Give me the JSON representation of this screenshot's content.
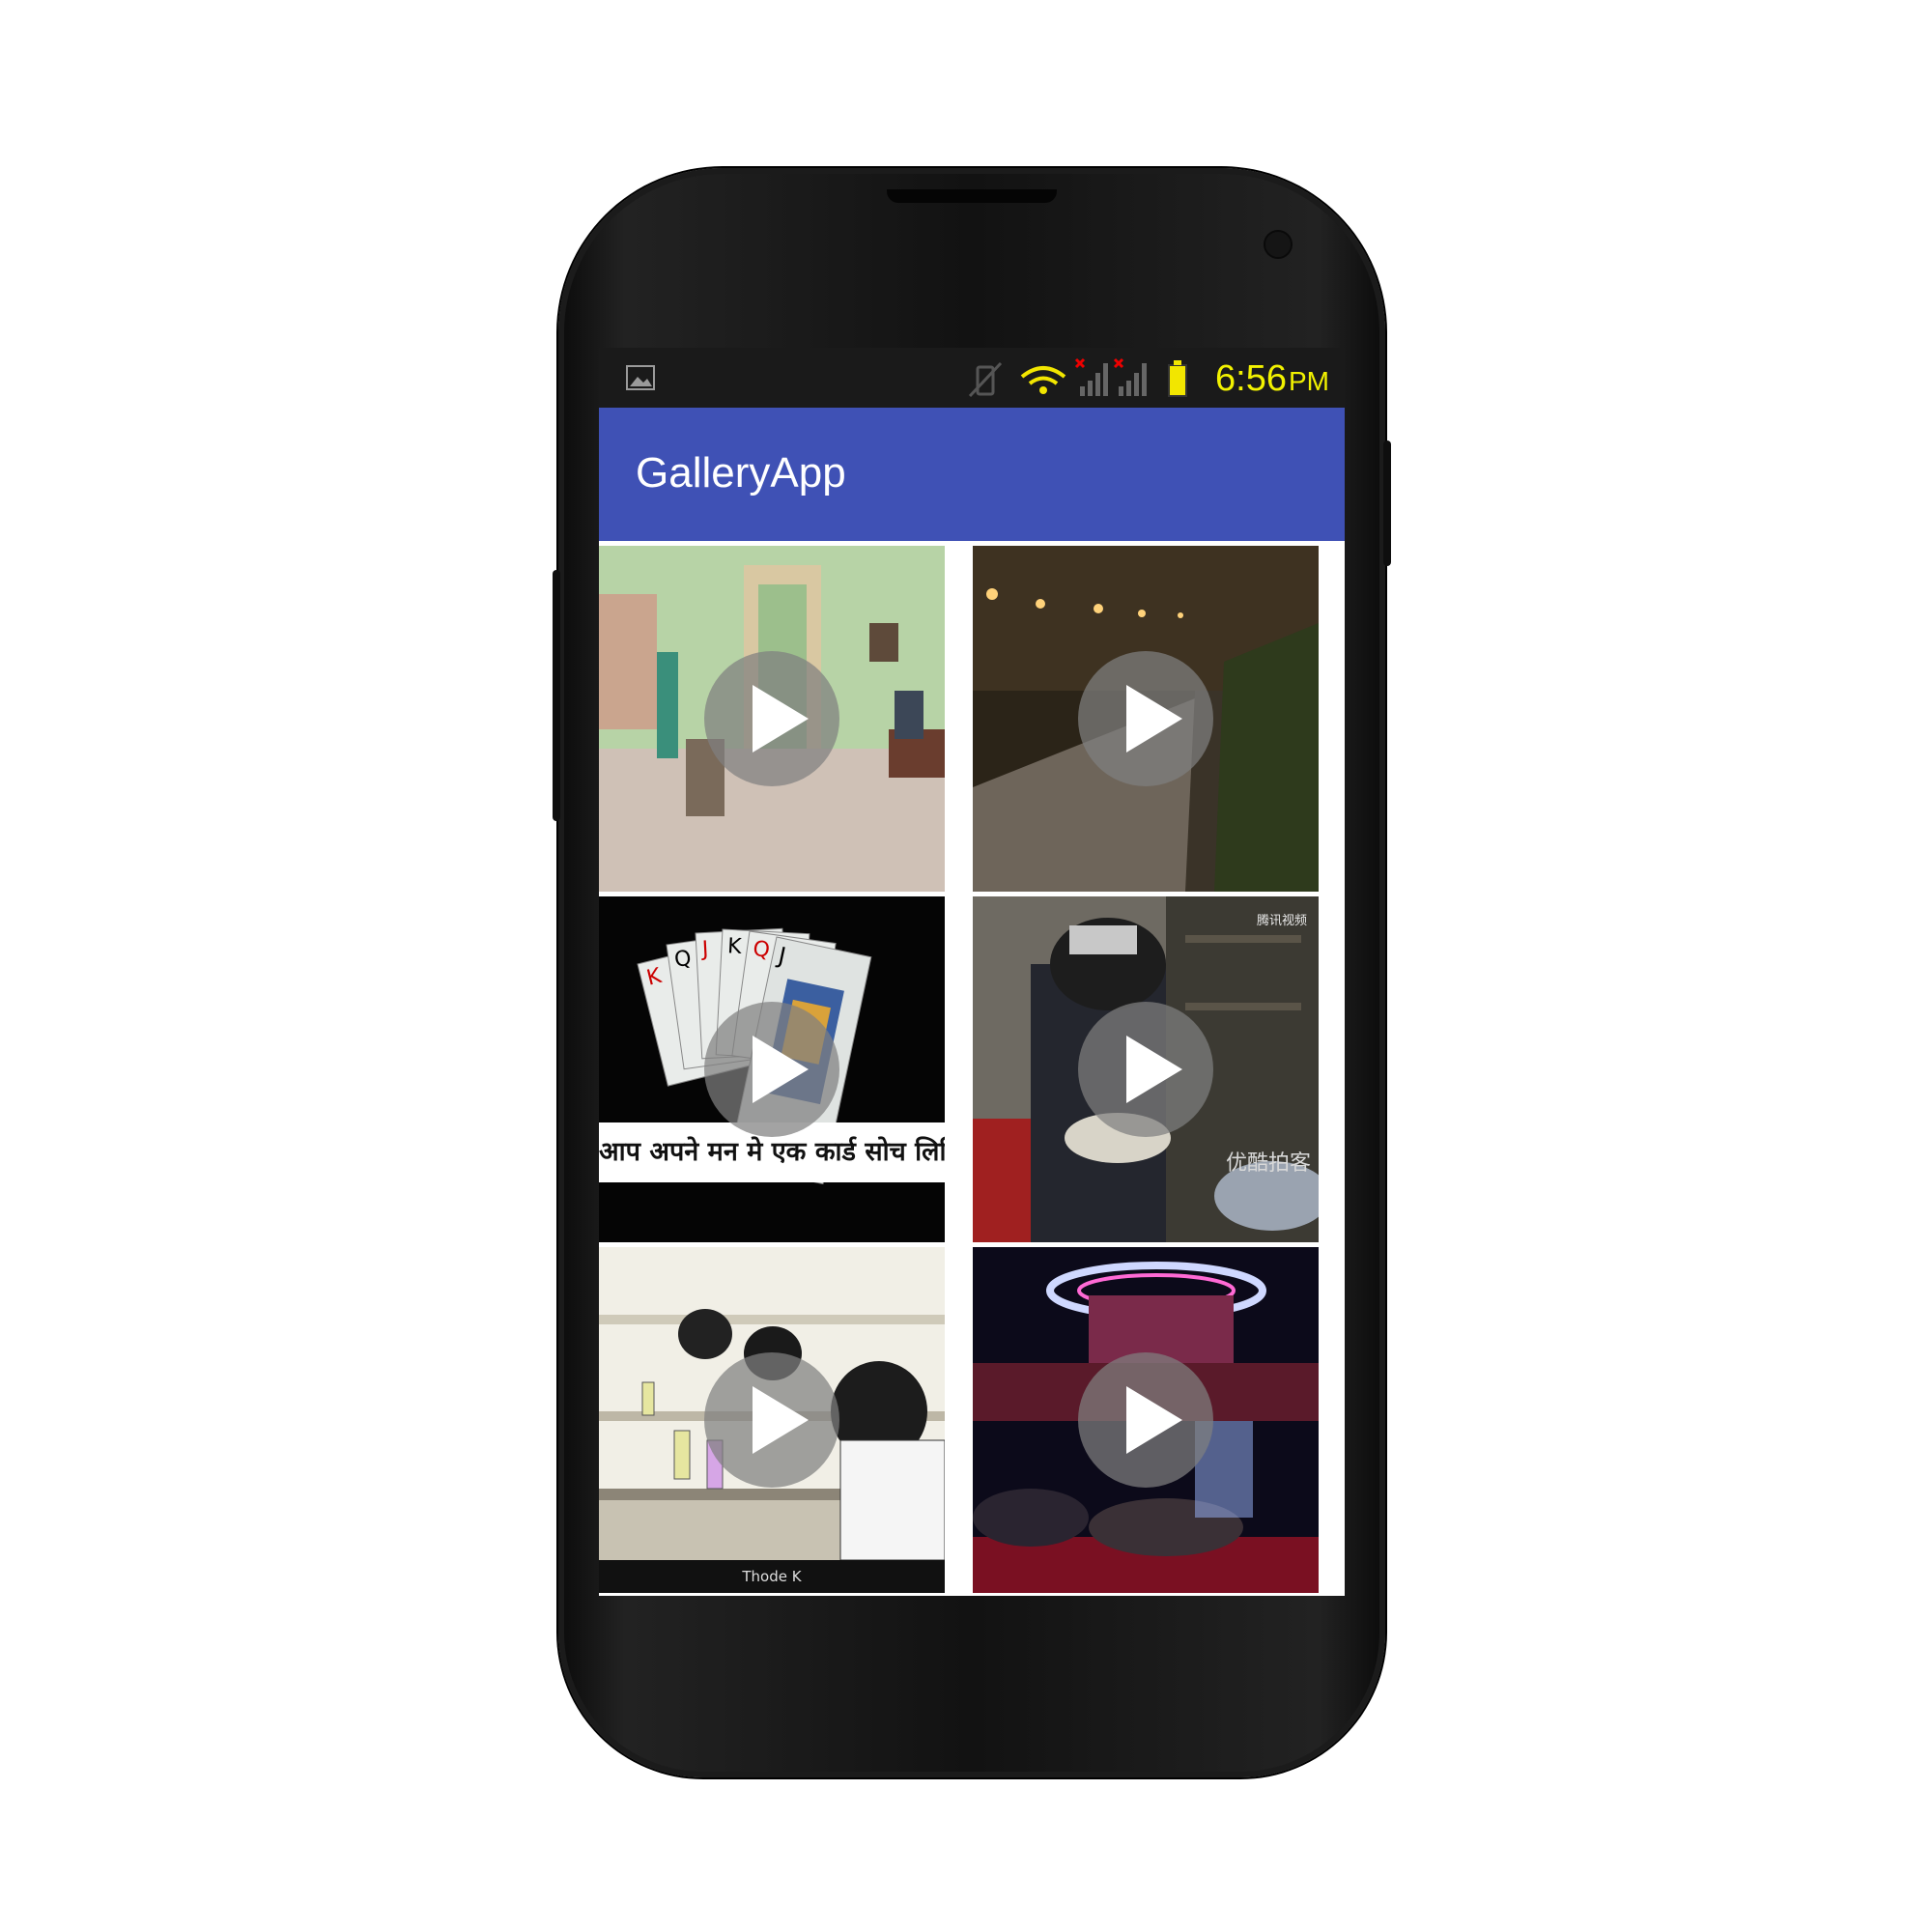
{
  "status_bar": {
    "time": "6:56",
    "ampm": "PM",
    "icons": [
      "image-notification-icon",
      "vibrate-off-icon",
      "wifi-icon",
      "signal-icon",
      "signal-icon",
      "battery-icon"
    ]
  },
  "app_bar": {
    "title": "GalleryApp"
  },
  "gallery": {
    "items": [
      {
        "name": "video-thumb-1",
        "caption": ""
      },
      {
        "name": "video-thumb-2",
        "caption": ""
      },
      {
        "name": "video-thumb-3",
        "caption": "आप अपने मन मे एक कार्ड सोच लिजिए"
      },
      {
        "name": "video-thumb-4",
        "caption": "优酷拍客",
        "watermark": "腾讯视频"
      },
      {
        "name": "video-thumb-5",
        "caption": "Thode K"
      },
      {
        "name": "video-thumb-6",
        "caption": ""
      }
    ]
  },
  "colors": {
    "app_bar": "#3f51b5",
    "status_bar": "#1a1a1a",
    "clock": "#f2f200"
  }
}
